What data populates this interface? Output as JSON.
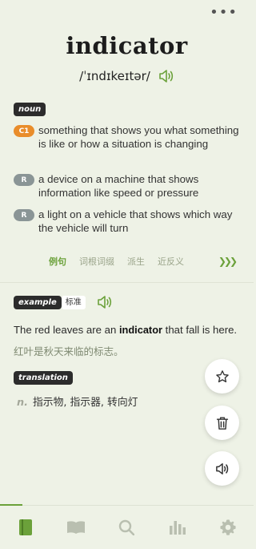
{
  "header": {
    "more_icon": "more-horizontal-icon",
    "word": "indicator",
    "phonetic": "/ˈɪndɪkeɪtər/",
    "speaker_icon": "speaker-icon",
    "accent_color": "#6ba13a"
  },
  "definitions": {
    "pos": "noun",
    "senses": [
      {
        "level": "C1",
        "level_color": "#e98d2b",
        "text": "something that shows you what something is like or how a situation is changing"
      },
      {
        "level": "R",
        "level_color": "#8a9596",
        "text": "a device on a machine that shows information like speed or pressure"
      },
      {
        "level": "R",
        "level_color": "#8a9596",
        "text": "a light on a vehicle that shows which way the vehicle will turn"
      }
    ]
  },
  "tabs": {
    "items": [
      "例句",
      "词根词缀",
      "派生",
      "近反义"
    ],
    "active_index": 0,
    "more_icon": "chevrons-right-icon"
  },
  "example": {
    "tag": "example",
    "source": "标准",
    "en_before": "The red leaves are an ",
    "en_keyword": "indicator",
    "en_after": " that fall is here.",
    "zh": "红叶是秋天来临的标志。"
  },
  "translation": {
    "tag": "translation",
    "pos": "n.",
    "text": "指示物, 指示器, 转向灯"
  },
  "fab": {
    "star_icon": "star-icon",
    "trash_icon": "trash-icon",
    "speaker_icon": "speaker-icon"
  },
  "tabbar": {
    "items": [
      {
        "icon": "book-icon",
        "active": true
      },
      {
        "icon": "open-book-icon",
        "active": false
      },
      {
        "icon": "search-icon",
        "active": false
      },
      {
        "icon": "bar-chart-icon",
        "active": false
      },
      {
        "icon": "gear-icon",
        "active": false
      }
    ],
    "active_color": "#6ba13a",
    "inactive_color": "#b9bfb0"
  }
}
